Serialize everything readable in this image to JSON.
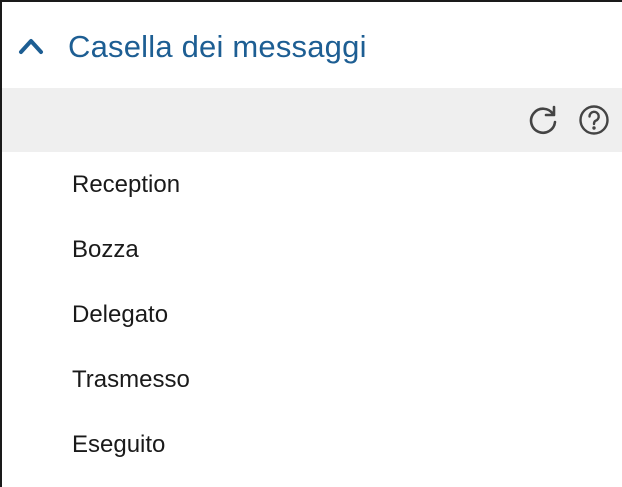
{
  "panel": {
    "title": "Casella dei messaggi",
    "collapse_icon": "chevron-up-icon",
    "accent_color": "#1d5e93",
    "toolbar": {
      "background": "#efefef",
      "icons": [
        "refresh-icon",
        "help-icon"
      ]
    },
    "items": [
      {
        "label": "Reception"
      },
      {
        "label": "Bozza"
      },
      {
        "label": "Delegato"
      },
      {
        "label": "Trasmesso"
      },
      {
        "label": "Eseguito"
      }
    ]
  }
}
